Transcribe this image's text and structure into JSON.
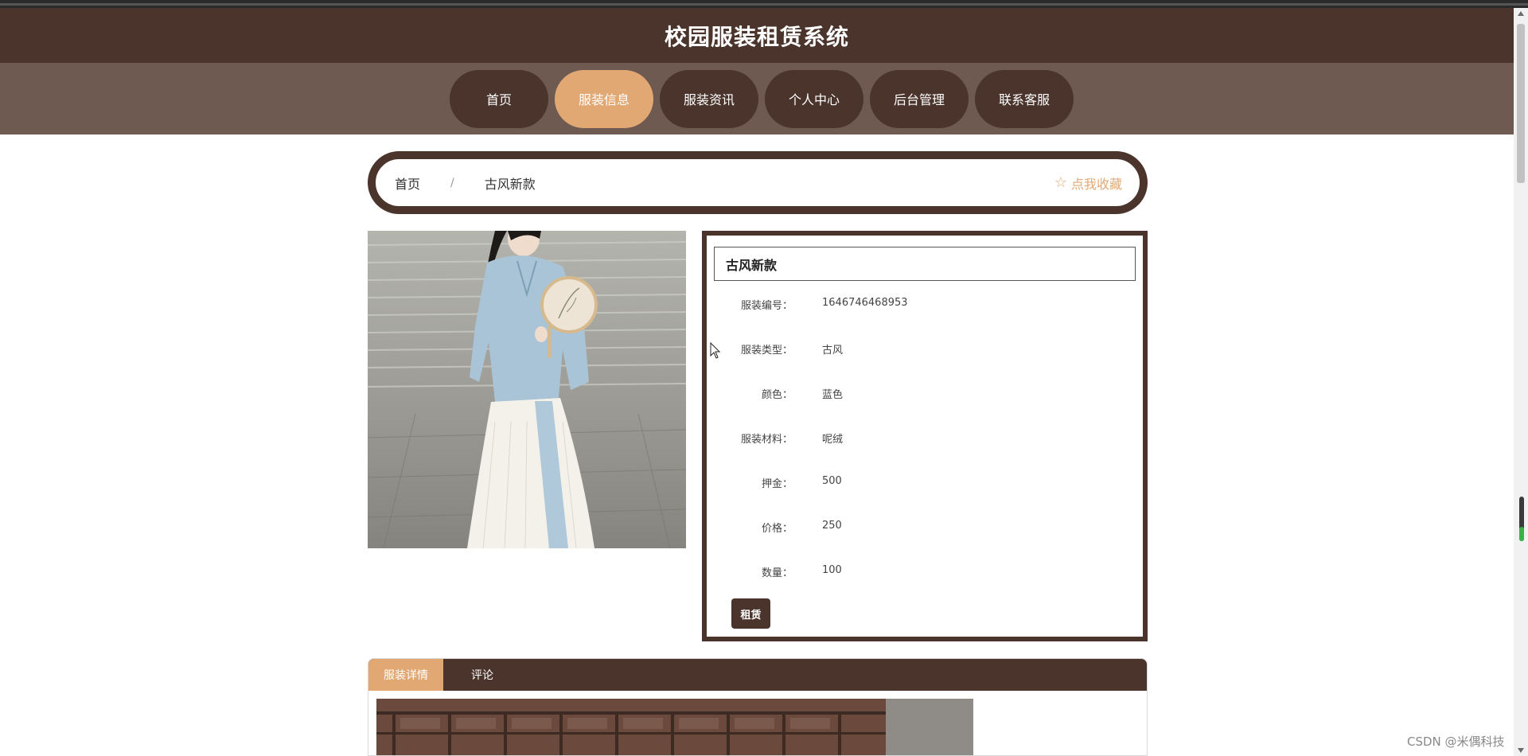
{
  "app": {
    "title": "校园服装租赁系统"
  },
  "nav": {
    "items": [
      {
        "label": "首页",
        "active": false
      },
      {
        "label": "服装信息",
        "active": true
      },
      {
        "label": "服装资讯",
        "active": false
      },
      {
        "label": "个人中心",
        "active": false
      },
      {
        "label": "后台管理",
        "active": false
      },
      {
        "label": "联系客服",
        "active": false
      }
    ]
  },
  "breadcrumb": {
    "home": "首页",
    "separator": "/",
    "current": "古风新款",
    "favorite_label": "点我收藏",
    "favorite_icon": "star-outline-icon"
  },
  "product": {
    "name": "古风新款",
    "fields": [
      {
        "label": "服装编号：",
        "value": "1646746468953"
      },
      {
        "label": "服装类型：",
        "value": "古风"
      },
      {
        "label": "颜色：",
        "value": "蓝色"
      },
      {
        "label": "服装材料：",
        "value": "呢绒"
      },
      {
        "label": "押金：",
        "value": "500"
      },
      {
        "label": "价格：",
        "value": "250"
      },
      {
        "label": "数量：",
        "value": "100"
      }
    ],
    "rent_button": "租赁"
  },
  "detail_tabs": {
    "items": [
      {
        "label": "服装详情",
        "active": true
      },
      {
        "label": "评论",
        "active": false
      }
    ]
  },
  "watermark": "CSDN @米偶科技",
  "colors": {
    "primary": "#4a342c",
    "nav_bg": "#6e5a51",
    "accent": "#e2a874"
  }
}
